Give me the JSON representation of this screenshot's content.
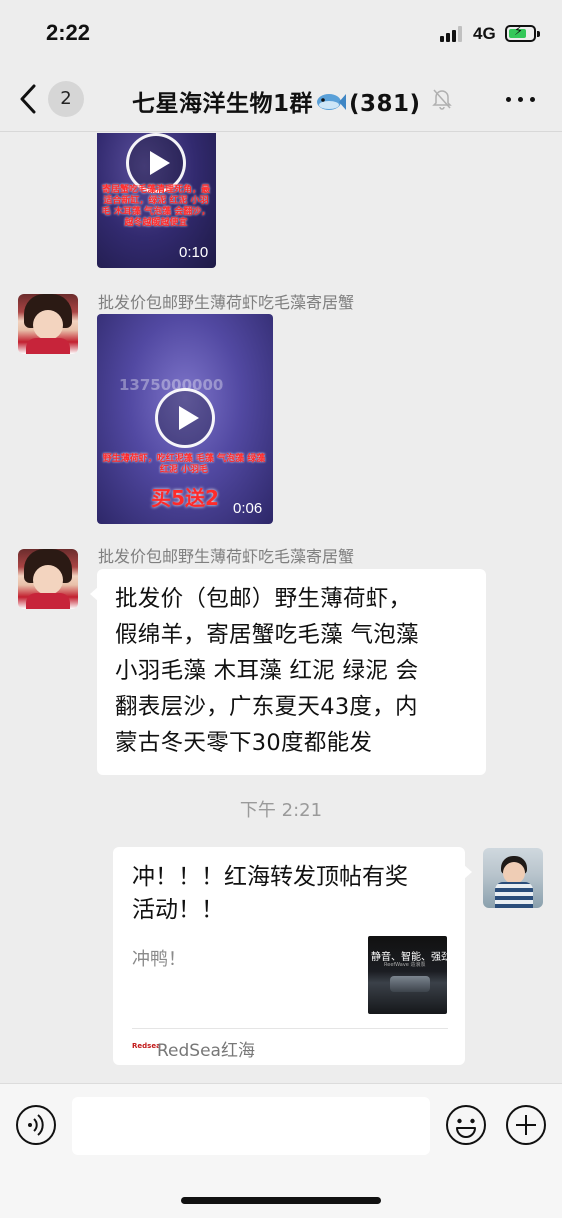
{
  "status_bar": {
    "time": "2:22",
    "network": "4G",
    "battery_level": 0.75,
    "battery_color": "#34c759"
  },
  "nav": {
    "unread_count": "2",
    "title_prefix": "七星海洋生物1群",
    "title_suffix": "(381)",
    "icons": [
      "back-chevron-icon",
      "fish-icon",
      "mute-bell-icon",
      "more-dots-icon"
    ]
  },
  "messages": {
    "video_top": {
      "duration": "0:10",
      "caption": "寄居蟹吃毛藻清理死角，最适合新缸，绿泥 红泥 小羽毛 木耳藻 气泡藻 会翻沙，越冬越暖越便宜"
    },
    "video_mid": {
      "sender": "批发价包邮野生薄荷虾吃毛藻寄居蟹",
      "duration": "0:06",
      "watermark": "1375000000",
      "caption": "野生薄荷虾，吃红泥藻 毛藻 气泡藻 绿藻 红泥 小羽毛",
      "promo": "买5送2"
    },
    "text_msg": {
      "sender": "批发价包邮野生薄荷虾吃毛藻寄居蟹",
      "lines": [
        "批发价（包邮）野生薄荷虾，",
        "假绵羊，寄居蟹吃毛藻 气泡藻",
        "小羽毛藻 木耳藻 红泥 绿泥 会",
        "翻表层沙，广东夏天43度，内",
        "蒙古冬天零下30度都能发"
      ]
    },
    "timestamp": "下午 2:21",
    "link_card": {
      "title_line1": "冲！！！红海转发顶帖有奖",
      "title_line2": "活动！！",
      "description": "冲鸭！",
      "thumb_text": "静音、智能、强劲",
      "thumb_sub": "ReefWave 造浪泵",
      "source_icon_text": "Redsea",
      "source": "RedSea红海"
    }
  },
  "input_bar": {
    "placeholder": "",
    "icons": [
      "voice-icon",
      "emoji-icon",
      "plus-icon"
    ]
  }
}
